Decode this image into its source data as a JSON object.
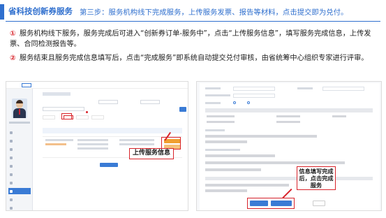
{
  "header": {
    "title": "省科技创新券服务",
    "subtitle": "第三步：服务机构线下完成服务，上传服务发票、报告等材料，点击提交即为兑付。"
  },
  "steps": [
    {
      "number": "①",
      "text": "服务机构线下服务，服务完成后可进入“创新券订单-服务中”，点击“上传服务信息”，填写服务完成信息，上传发票、合同检测报告等。"
    },
    {
      "number": "②",
      "text": "服务结束且服务完成信息填写后，点击“完成服务”即系统自动提交兑付审核，由省统筹中心组织专家进行评审。"
    }
  ],
  "callouts": {
    "upload": "上传服务信息",
    "complete": "信息填写完成后，点击完成服务"
  },
  "colors": {
    "brand": "#2f6fce",
    "highlight": "#d8232a",
    "accent_button": "#3a7bd5",
    "warn_button": "#f0a030"
  },
  "icons": {
    "avatar": "person-avatar-icon"
  }
}
